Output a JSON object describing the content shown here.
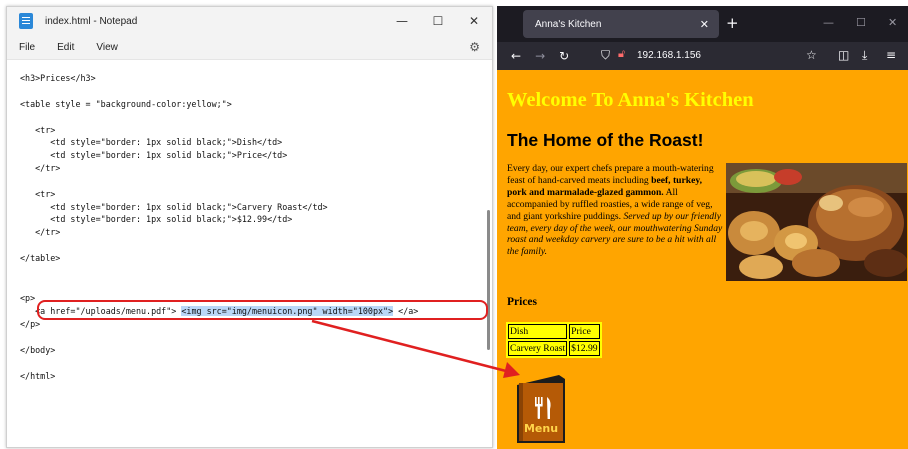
{
  "notepad": {
    "title": "index.html - Notepad",
    "menus": [
      "File",
      "Edit",
      "View"
    ],
    "window_buttons": [
      "—",
      "☐",
      "✕"
    ],
    "code_lines": [
      "<h3>Prices</h3>",
      "<table style = \"background-color:yellow;\">",
      "   <tr>",
      "      <td style=\"border: 1px solid black;\">Dish</td>",
      "      <td style=\"border: 1px solid black;\">Price</td>",
      "   </tr>",
      "   <tr>",
      "      <td style=\"border: 1px solid black;\">Carvery Roast</td>",
      "      <td style=\"border: 1px solid black;\">$12.99</td>",
      "   </tr>",
      "</table>",
      "<p>",
      "   <a href=\"/uploads/menu.pdf\"> ",
      "<img src=\"img/menuicon.png\" width=\"100px\">",
      " </a>",
      "</p>",
      "</body>",
      "</html>"
    ]
  },
  "browser": {
    "tab_title": "Anna's Kitchen",
    "url": "192.168.1.156",
    "new_tab": "+",
    "tab_close": "✕"
  },
  "page": {
    "h1": "Welcome To Anna's Kitchen",
    "h2": "The Home of the Roast!",
    "para": {
      "intro": "Every day, our expert chefs prepare a mouth-watering feast of hand-carved meats including ",
      "bold": "beef, turkey, pork and marmalade-glazed gammon.",
      "middle": " All accompanied by ruffled roasties, a wide range of veg, and giant yorkshire puddings. ",
      "italic": "Served up by our friendly team, every day of the week, our mouthwatering Sunday roast and weekday carvery are sure to be a hit with all the family."
    },
    "prices_heading": "Prices",
    "table": [
      [
        "Dish",
        "Price"
      ],
      [
        "Carvery Roast",
        "$12.99"
      ]
    ],
    "menu_icon_label": "Menu"
  },
  "colors": {
    "page_bg": "#ffa500",
    "heading_yellow": "#ffff00",
    "annotation_red": "#e02020",
    "selection_blue": "#b9d7f7"
  }
}
